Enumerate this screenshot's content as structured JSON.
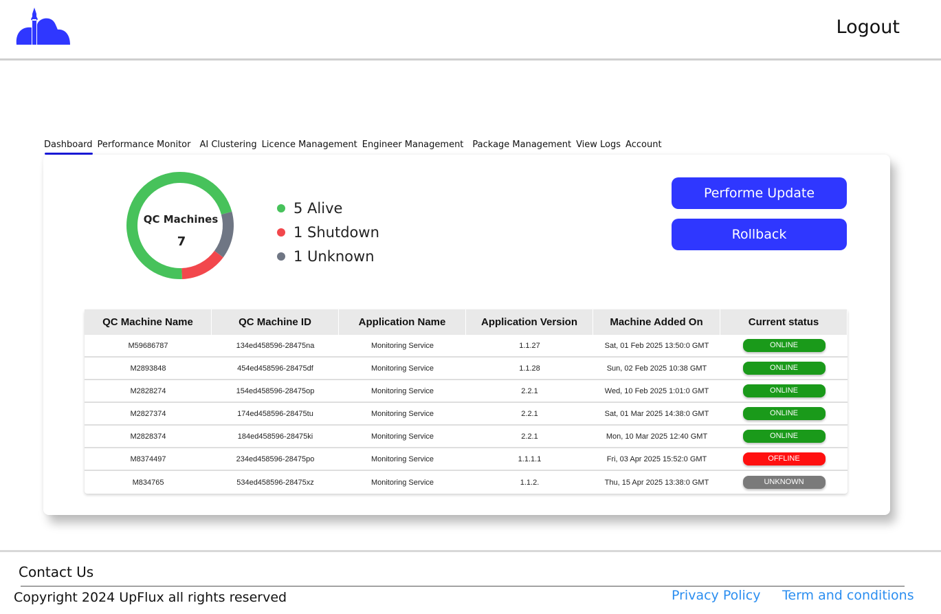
{
  "header": {
    "logout_label": "Logout"
  },
  "tabs": [
    {
      "label": "Dashboard",
      "active": true
    },
    {
      "label": "Performance Monitor"
    },
    {
      "label": "AI Clustering"
    },
    {
      "label": "Licence Management"
    },
    {
      "label": "Engineer Management"
    },
    {
      "label": "Package Management"
    },
    {
      "label": "View Logs"
    },
    {
      "label": "Account"
    }
  ],
  "summary": {
    "title": "QC Machines",
    "total": "7",
    "segments": [
      {
        "label": "5 Alive",
        "value": 5,
        "color": "#47c25b"
      },
      {
        "label": "1 Shutdown",
        "value": 1,
        "color": "#f2474c"
      },
      {
        "label": "1 Unknown",
        "value": 1,
        "color": "#6f7684"
      }
    ]
  },
  "actions": {
    "update_label": "Performe Update",
    "rollback_label": "Rollback"
  },
  "table": {
    "headers": [
      "QC Machine Name",
      "QC Machine ID",
      "Application Name",
      "Application Version",
      "Machine Added On",
      "Current status"
    ],
    "rows": [
      [
        "M59686787",
        "134ed458596-28475na",
        "Monitoring Service",
        "1.1.27",
        "Sat, 01 Feb 2025 13:50:0 GMT",
        "ONLINE"
      ],
      [
        "M2893848",
        "454ed458596-28475df",
        "Monitoring Service",
        "1.1.28",
        "Sun, 02 Feb 2025 10:38   GMT",
        "ONLINE"
      ],
      [
        "M2828274",
        "154ed458596-28475op",
        "Monitoring Service",
        "2.2.1",
        "Wed, 10 Feb 2025 1:01:0 GMT",
        "ONLINE"
      ],
      [
        "M2827374",
        "174ed458596-28475tu",
        "Monitoring Service",
        "2.2.1",
        "Sat, 01 Mar 2025 14:38:0 GMT",
        "ONLINE"
      ],
      [
        "M2828374",
        "184ed458596-28475ki",
        "Monitoring Service",
        "2.2.1",
        "Mon, 10 Mar 2025 12:40 GMT",
        "ONLINE"
      ],
      [
        "M8374497",
        "234ed458596-28475po",
        "Monitoring Service",
        "1.1.1.1",
        "Fri, 03 Apr 2025 15:52:0 GMT",
        "OFFLINE"
      ],
      [
        "M834765",
        "534ed458596-28475xz",
        "Monitoring Service",
        "1.1.2.",
        "Thu, 15 Apr 2025 13:38:0 GMT",
        "UNKNOWN"
      ]
    ]
  },
  "status_colors": {
    "ONLINE": "#1a9a1a",
    "OFFLINE": "#ff1010",
    "UNKNOWN": "#7a7a7a"
  },
  "footer": {
    "contact_label": "Contact Us",
    "copyright": "Copyright 2024 UpFlux all rights reserved",
    "privacy_label": "Privacy Policy",
    "terms_label": "Term and conditions"
  }
}
